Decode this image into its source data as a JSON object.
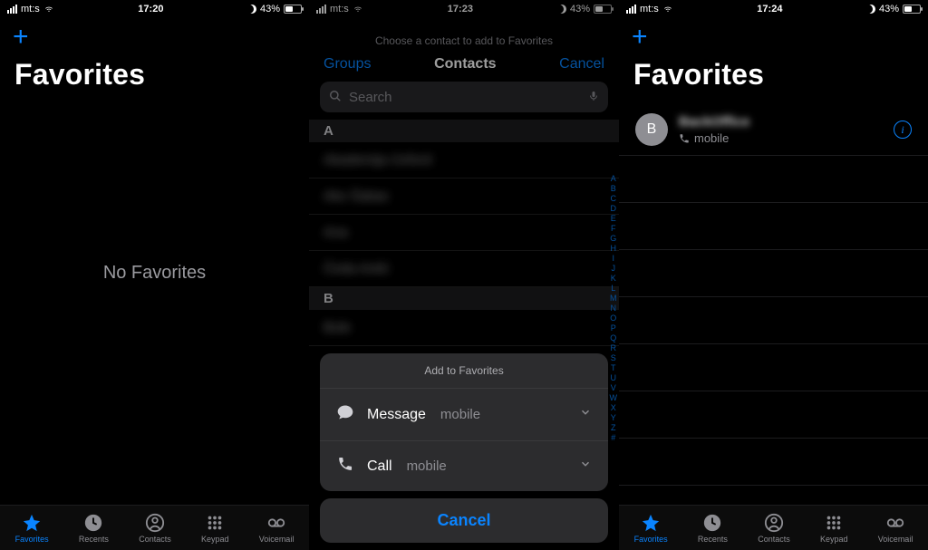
{
  "status": {
    "carrier": "mt:s",
    "battery_pct": "43%",
    "times": [
      "17:20",
      "17:23",
      "17:24"
    ]
  },
  "accent": "#0a84ff",
  "pane1": {
    "title": "Favorites",
    "empty_state": "No Favorites"
  },
  "pane2": {
    "instruction": "Choose a contact to add to Favorites",
    "nav": {
      "left": "Groups",
      "title": "Contacts",
      "right": "Cancel"
    },
    "search_placeholder": "Search",
    "sections": [
      {
        "letter": "A",
        "items": [
          "Akademija Oxford",
          "Ako Šabac",
          "Ana",
          "Čeda Antić"
        ]
      },
      {
        "letter": "B",
        "items": [
          "Bole"
        ]
      }
    ],
    "alpha_index": [
      "A",
      "B",
      "C",
      "D",
      "E",
      "F",
      "G",
      "H",
      "I",
      "J",
      "K",
      "L",
      "M",
      "N",
      "O",
      "P",
      "Q",
      "R",
      "S",
      "T",
      "U",
      "V",
      "W",
      "X",
      "Y",
      "Z",
      "#"
    ],
    "sheet": {
      "title": "Add to Favorites",
      "options": [
        {
          "icon": "message",
          "label": "Message",
          "sub": "mobile"
        },
        {
          "icon": "call",
          "label": "Call",
          "sub": "mobile"
        }
      ],
      "cancel": "Cancel"
    }
  },
  "pane3": {
    "title": "Favorites",
    "entries": [
      {
        "initial": "B",
        "name": "BackOffice",
        "kind_label": "mobile",
        "icon": "phone"
      }
    ]
  },
  "tabs": [
    {
      "key": "favorites",
      "label": "Favorites"
    },
    {
      "key": "recents",
      "label": "Recents"
    },
    {
      "key": "contacts",
      "label": "Contacts"
    },
    {
      "key": "keypad",
      "label": "Keypad"
    },
    {
      "key": "voicemail",
      "label": "Voicemail"
    }
  ]
}
